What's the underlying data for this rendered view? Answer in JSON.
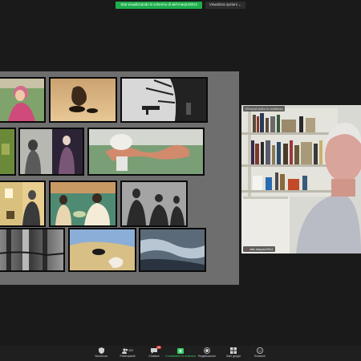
{
  "banner": {
    "sharing_text": "Stai visualizzando lo schermo di wkf-marpro2014",
    "view_options_label": "Visualizza opzioni ⌄"
  },
  "video": {
    "label": "Rimuovi video in evidenza",
    "participant_name": "wkf-marpro2014"
  },
  "toolbar": {
    "items": [
      {
        "label": "Sicurezza",
        "icon": "shield-icon"
      },
      {
        "label": "Partecipanti",
        "icon": "participants-icon",
        "count": "303"
      },
      {
        "label": "Chattare",
        "icon": "chat-icon",
        "badge": "36"
      },
      {
        "label": "Condividere lo schermo",
        "icon": "share-screen-icon"
      },
      {
        "label": "Registrazione",
        "icon": "record-icon"
      },
      {
        "label": "Sale gruppi",
        "icon": "breakout-rooms-icon"
      },
      {
        "label": "Reazioni",
        "icon": "reactions-icon"
      }
    ]
  },
  "colors": {
    "accent_green": "#1fae4c",
    "toolbar_bg": "#1f1f1f",
    "slide_bg": "#6e6e6e"
  }
}
